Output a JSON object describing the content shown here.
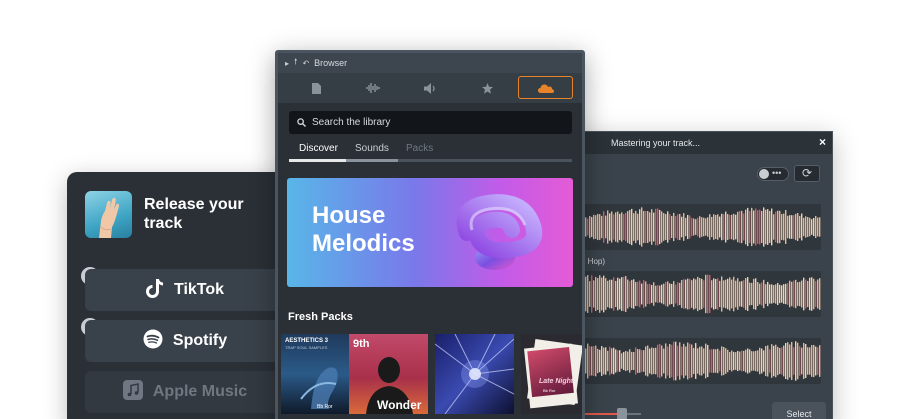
{
  "release": {
    "title": "Release your track",
    "platforms": [
      {
        "name": "TikTok",
        "checked": true,
        "icon": "tiktok-icon"
      },
      {
        "name": "Spotify",
        "checked": true,
        "icon": "spotify-icon"
      },
      {
        "name": "Apple Music",
        "checked": false,
        "icon": "apple-music-icon"
      }
    ]
  },
  "mastering": {
    "title": "Mastering your track...",
    "close": "×",
    "toggle_dots": "•••",
    "refresh": "⟳",
    "track_label": "n Hop)",
    "select_label": "Select"
  },
  "browser": {
    "title": "Browser",
    "toolbar": [
      "file-icon",
      "waveform-icon",
      "speaker-icon",
      "star-icon",
      "cloud-icon"
    ],
    "search_placeholder": "Search the library",
    "tabs": [
      "Discover",
      "Sounds",
      "Packs"
    ],
    "banner_title": "House Melodics",
    "fresh_title": "Fresh Packs",
    "packs": [
      {
        "line1": "AESTHETICS 3",
        "line2": "TRAP SOUL SAMPLES",
        "foot": "Bb Ror"
      },
      {
        "top": "9th",
        "bottom": "Wonder"
      },
      {
        "line1": "",
        "line2": ""
      },
      {
        "line1": "Late Night",
        "line2": "Bb Ror"
      }
    ]
  },
  "colors": {
    "accent_cloud": "#e8832a",
    "panel_dark": "#2a3036",
    "wave_tone": "#e8c8a8"
  }
}
